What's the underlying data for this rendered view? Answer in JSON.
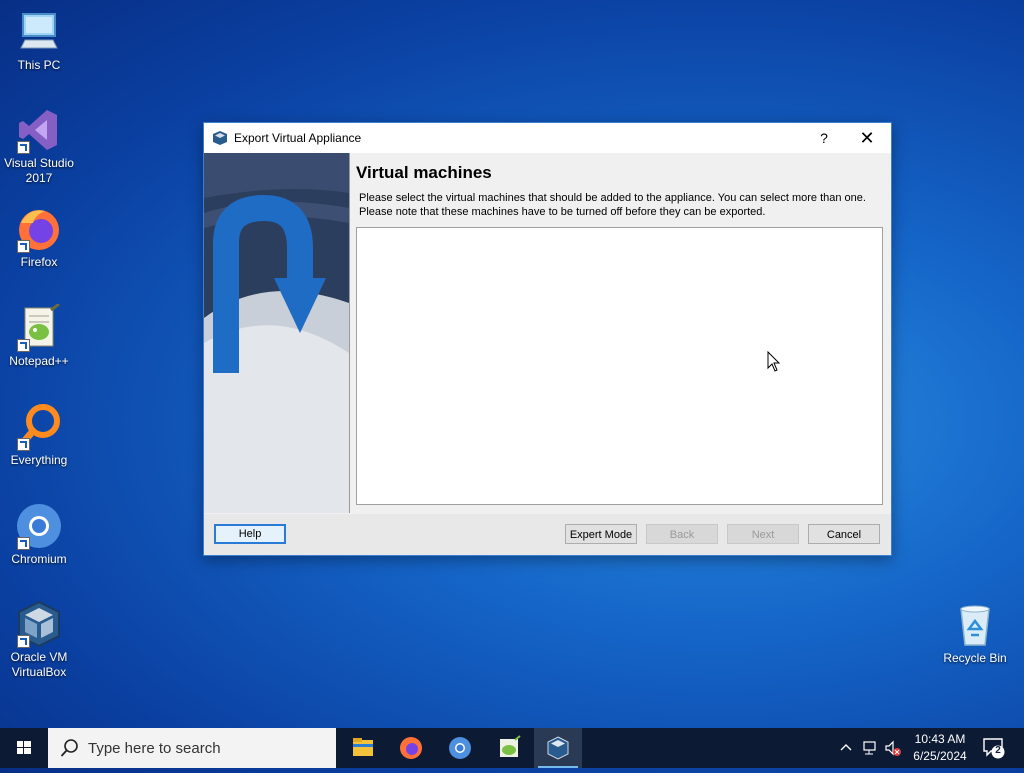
{
  "desktop": {
    "icons": [
      {
        "label": "This PC"
      },
      {
        "label": "Visual Studio 2017"
      },
      {
        "label": "Firefox"
      },
      {
        "label": "Notepad++"
      },
      {
        "label": "Everything"
      },
      {
        "label": "Chromium"
      },
      {
        "label": "Oracle VM VirtualBox"
      },
      {
        "label": "Recycle Bin"
      }
    ]
  },
  "dialog": {
    "title": "Export Virtual Appliance",
    "help_glyph": "?",
    "close_glyph": "✕",
    "page_title": "Virtual machines",
    "description_line1": "Please select the virtual machines that should be added to the appliance. You can select more than one.",
    "description_line2": "Please note that these machines have to be turned off before they can be exported.",
    "vm_list": [],
    "buttons": {
      "help": "Help",
      "expert": "Expert Mode",
      "back": "Back",
      "next": "Next",
      "cancel": "Cancel"
    }
  },
  "taskbar": {
    "search_placeholder": "Type here to search",
    "apps": [
      "File Explorer",
      "Firefox",
      "Chromium",
      "Notepad++",
      "Oracle VM VirtualBox"
    ],
    "time": "10:43 AM",
    "date": "6/25/2024",
    "notification_count": "2"
  },
  "colors": {
    "accent": "#2a7bd8",
    "taskbar": "#0d1a33",
    "desktop": "#1565c8"
  }
}
